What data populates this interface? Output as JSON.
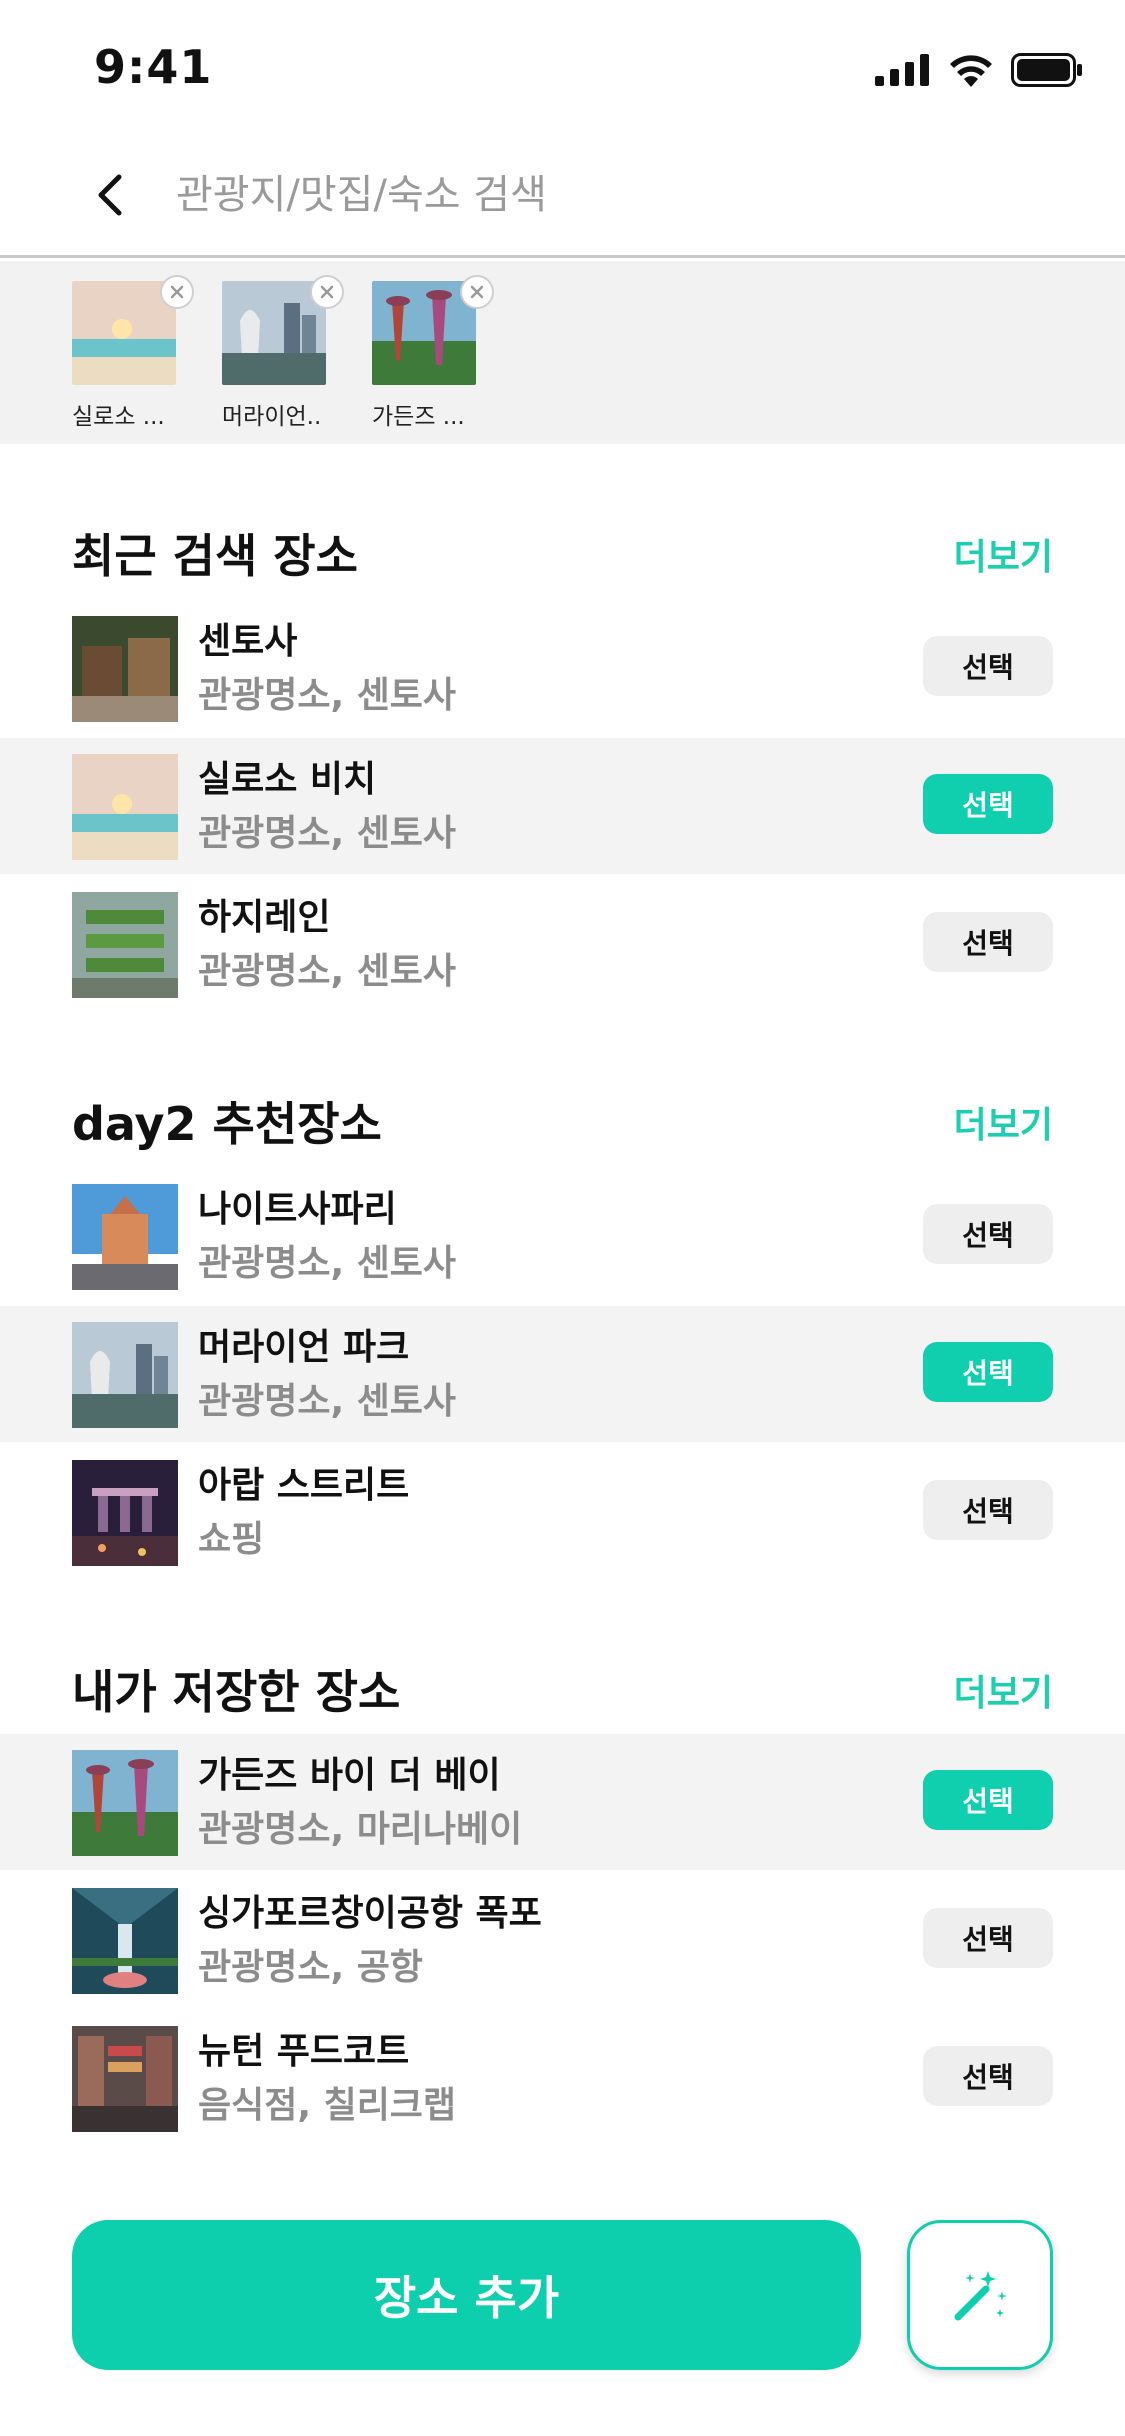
{
  "status_bar": {
    "time": "9:41"
  },
  "header": {
    "search_placeholder": "관광지/맛집/숙소 검색"
  },
  "selected": [
    {
      "label": "실로소 ..."
    },
    {
      "label": "머라이언.."
    },
    {
      "label": "가든즈 ..."
    }
  ],
  "recent": {
    "title": "최근 검색 장소",
    "more": "더보기",
    "items": [
      {
        "name": "센토사",
        "sub": "관광명소, 센토사",
        "button": "선택"
      },
      {
        "name": "실로소 비치",
        "sub": "관광명소, 센토사",
        "button": "선택"
      },
      {
        "name": "하지레인",
        "sub": "관광명소, 센토사",
        "button": "선택"
      }
    ]
  },
  "day2": {
    "title": "day2 추천장소",
    "more": "더보기",
    "items": [
      {
        "name": "나이트사파리",
        "sub": "관광명소, 센토사",
        "button": "선택"
      },
      {
        "name": "머라이언 파크",
        "sub": "관광명소, 센토사",
        "button": "선택"
      },
      {
        "name": "아랍 스트리트",
        "sub": "쇼핑",
        "button": "선택"
      }
    ]
  },
  "saved": {
    "title": "내가 저장한 장소",
    "more": "더보기",
    "items": [
      {
        "name": "가든즈 바이 더 베이",
        "sub": "관광명소, 마리나베이",
        "button": "선택"
      },
      {
        "name": "싱가포르창이공항 폭포",
        "sub": "관광명소, 공항",
        "button": "선택"
      },
      {
        "name": "뉴턴 푸드코트",
        "sub": "음식점, 칠리크랩",
        "button": "선택"
      }
    ]
  },
  "bottom": {
    "add_label": "장소 추가",
    "magic_icon": "magic-wand-icon"
  },
  "colors": {
    "accent": "#0dcfad",
    "button_gray": "#eeeeee",
    "highlight_row": "#f3f3f3"
  }
}
